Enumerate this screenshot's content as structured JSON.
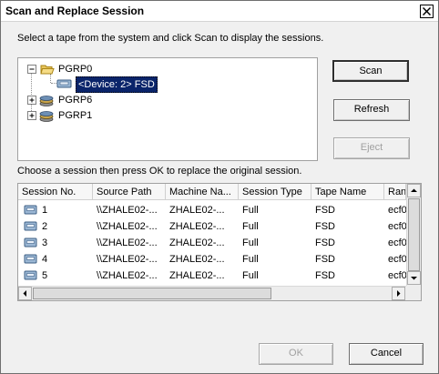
{
  "window": {
    "title": "Scan and Replace Session"
  },
  "instructions": {
    "tape": "Select a tape from the system and click Scan to display the sessions.",
    "session": "Choose a session then press OK to replace the original session."
  },
  "tree": {
    "groups": [
      {
        "label": "PGRP0",
        "expanded": true,
        "children": [
          {
            "label": "<Device: 2> FSD",
            "selected": true
          }
        ]
      },
      {
        "label": "PGRP6",
        "expanded": false
      },
      {
        "label": "PGRP1",
        "expanded": false
      }
    ]
  },
  "buttons": {
    "scan": "Scan",
    "refresh": "Refresh",
    "eject": "Eject",
    "ok": "OK",
    "cancel": "Cancel"
  },
  "table": {
    "columns": [
      "Session No.",
      "Source Path",
      "Machine Na...",
      "Session Type",
      "Tape Name",
      "Ran"
    ],
    "rows": [
      [
        "1",
        "\\\\ZHALE02-...",
        "ZHALE02-...",
        "Full",
        "FSD",
        "ecf0"
      ],
      [
        "2",
        "\\\\ZHALE02-...",
        "ZHALE02-...",
        "Full",
        "FSD",
        "ecf0"
      ],
      [
        "3",
        "\\\\ZHALE02-...",
        "ZHALE02-...",
        "Full",
        "FSD",
        "ecf0"
      ],
      [
        "4",
        "\\\\ZHALE02-...",
        "ZHALE02-...",
        "Full",
        "FSD",
        "ecf0"
      ],
      [
        "5",
        "\\\\ZHALE02-...",
        "ZHALE02-...",
        "Full",
        "FSD",
        "ecf0"
      ]
    ]
  },
  "colors": {
    "selection": "#0a246a",
    "disabled_text": "#a0a0a0"
  }
}
